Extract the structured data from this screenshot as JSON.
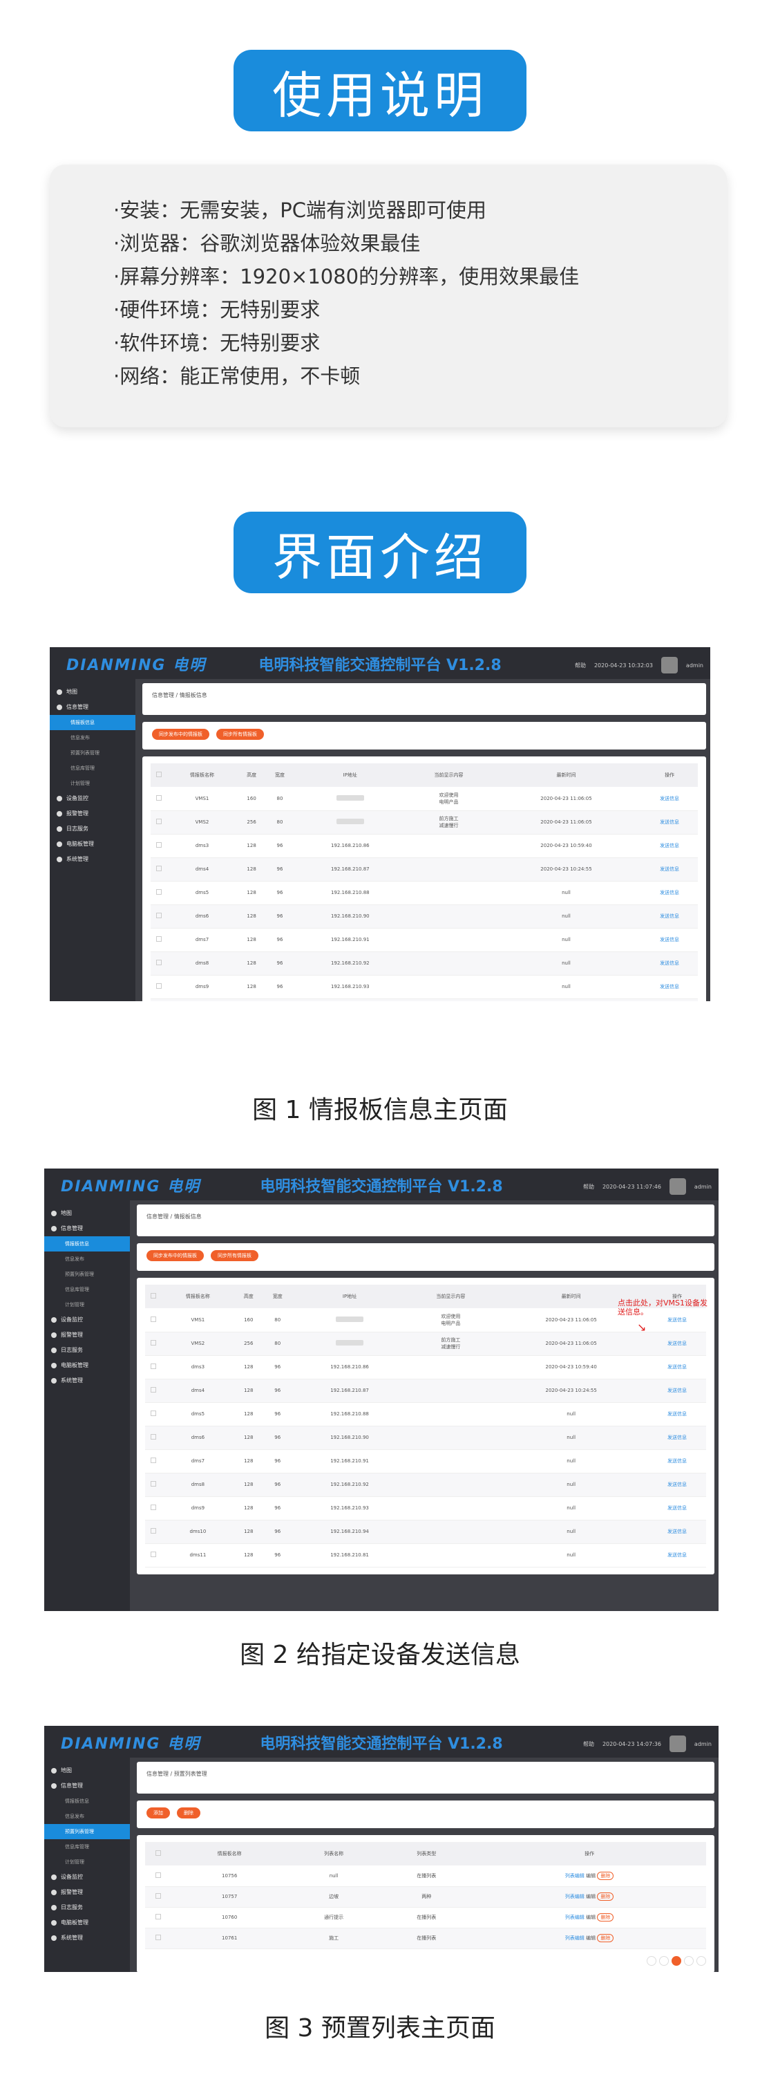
{
  "usage": {
    "title": "使用说明",
    "items": [
      "·安装：无需安装，PC端有浏览器即可使用",
      "·浏览器：谷歌浏览器体验效果最佳",
      "·屏幕分辨率：1920×1080的分辨率，使用效果最佳",
      "·硬件环境：无特别要求",
      "·软件环境：无特别要求",
      "·网络：能正常使用，不卡顿"
    ]
  },
  "intro": {
    "title": "界面介绍"
  },
  "app": {
    "logo": "DIANMING 电明",
    "title": "电明科技智能交通控制平台 V1.2.8",
    "user": "admin",
    "top_label": "帮助",
    "sidebar": [
      {
        "label": "地图",
        "type": "item"
      },
      {
        "label": "信息管理",
        "type": "item"
      },
      {
        "label": "情报板信息",
        "type": "sub-active"
      },
      {
        "label": "信息发布",
        "type": "sub"
      },
      {
        "label": "预置列表管理",
        "type": "sub"
      },
      {
        "label": "信息库管理",
        "type": "sub"
      },
      {
        "label": "计划管理",
        "type": "sub"
      },
      {
        "label": "设备监控",
        "type": "item"
      },
      {
        "label": "报警管理",
        "type": "item"
      },
      {
        "label": "日志服务",
        "type": "item"
      },
      {
        "label": "电脑板管理",
        "type": "item"
      },
      {
        "label": "系统管理",
        "type": "item"
      }
    ],
    "breadcrumb": "信息管理  /  情报板信息",
    "buttons": [
      "同步发布中的情报板",
      "同步所有情报板"
    ],
    "columns": [
      "",
      "情报板名称",
      "高度",
      "宽度",
      "IP地址",
      "当前显示内容",
      "最新时间",
      "操作"
    ],
    "rows": [
      [
        "VMS1",
        "160",
        "80",
        "",
        "欢迎使用\n电明产品",
        "2020-04-23 11:06:05",
        "发送信息"
      ],
      [
        "VMS2",
        "256",
        "80",
        "",
        "前方施工\n减速慢行",
        "2020-04-23 11:06:05",
        "发送信息"
      ],
      [
        "dms3",
        "128",
        "96",
        "192.168.210.86",
        "",
        "2020-04-23 10:59:40",
        "发送信息"
      ],
      [
        "dms4",
        "128",
        "96",
        "192.168.210.87",
        "",
        "2020-04-23 10:24:55",
        "发送信息"
      ],
      [
        "dms5",
        "128",
        "96",
        "192.168.210.88",
        "",
        "null",
        "发送信息"
      ],
      [
        "dms6",
        "128",
        "96",
        "192.168.210.90",
        "",
        "null",
        "发送信息"
      ],
      [
        "dms7",
        "128",
        "96",
        "192.168.210.91",
        "",
        "null",
        "发送信息"
      ],
      [
        "dms8",
        "128",
        "96",
        "192.168.210.92",
        "",
        "null",
        "发送信息"
      ],
      [
        "dms9",
        "128",
        "96",
        "192.168.210.93",
        "",
        "null",
        "发送信息"
      ],
      [
        "dms10",
        "128",
        "96",
        "192.168.210.94",
        "",
        "null",
        "发送信息"
      ],
      [
        "dms11",
        "128",
        "96",
        "192.168.210.81",
        "",
        "null",
        "发送信息"
      ]
    ],
    "date1": "2020-04-23 10:32:03",
    "date2": "2020-04-23 11:07:46",
    "date3": "2020-04-23 14:07:36"
  },
  "shot2": {
    "annotation": "点击此处，对VMS1设备发送信息。"
  },
  "shot3": {
    "breadcrumb": "信息管理  /  预置列表管理",
    "buttons": [
      "添加",
      "删除"
    ],
    "columns": [
      "",
      "情报板名称",
      "列表名称",
      "列表类型",
      "操作"
    ],
    "rows": [
      [
        "10756",
        "null",
        "在播列表",
        "列表编辑",
        "编辑",
        "删除"
      ],
      [
        "10757",
        "边坡",
        "两种",
        "列表编辑",
        "编辑",
        "删除"
      ],
      [
        "10760",
        "通行提示",
        "在播列表",
        "列表编辑",
        "编辑",
        "删除"
      ],
      [
        "10761",
        "施工",
        "在播列表",
        "列表编辑",
        "编辑",
        "删除"
      ]
    ]
  },
  "captions": [
    "图 1 情报板信息主页面",
    "图 2 给指定设备发送信息",
    "图 3 预置列表主页面"
  ]
}
